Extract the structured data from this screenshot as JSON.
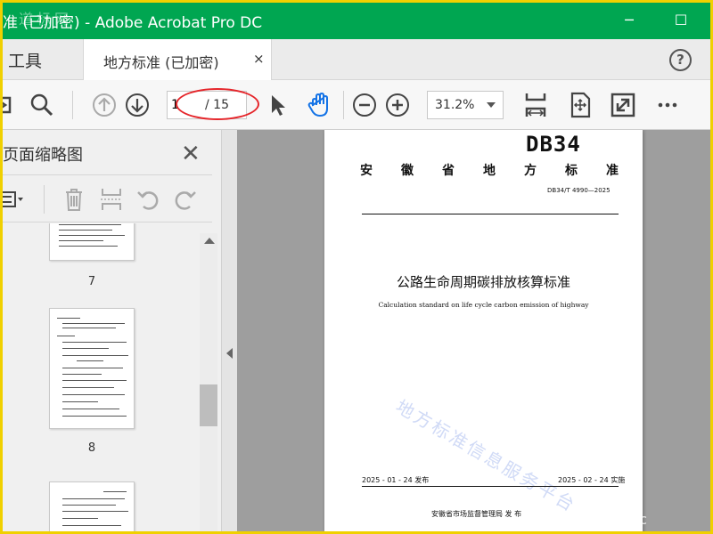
{
  "window": {
    "title": "准 (已加密) - Adobe Acrobat Pro DC",
    "title_watermark": "道标网",
    "minimize_glyph": "─",
    "maximize_glyph": "☐"
  },
  "tabs": {
    "tools_label": "工具",
    "document_label": "地方标准 (已加密)",
    "close_glyph": "×",
    "help_glyph": "?"
  },
  "toolbar": {
    "current_page": "1",
    "total_pages": "/ 15",
    "zoom": "31.2%"
  },
  "left_panel": {
    "title": "页面缩略图",
    "close_glyph": "✕",
    "thumbnail_numbers": [
      "7",
      "8"
    ]
  },
  "document": {
    "code": "DB34",
    "province_chars": [
      "安",
      "徽",
      "省",
      "地",
      "方",
      "标",
      "准"
    ],
    "standard_number": "DB34/T 4990—2025",
    "title_cn": "公路生命周期碳排放核算标准",
    "title_en": "Calculation standard on life cycle carbon emission of highway",
    "watermark": "地方标准信息服务平台",
    "publish_date": "2025 - 01 - 24 发布",
    "implement_date": "2025 - 02 - 24 实施",
    "publisher": "安徽省市场监督管理局    发 布",
    "site_watermark": "www.cnc"
  },
  "colors": {
    "titlebar": "#00a651",
    "frame": "#f0d000",
    "hand_tool": "#1473e6",
    "annotation_red": "#e5252a"
  }
}
